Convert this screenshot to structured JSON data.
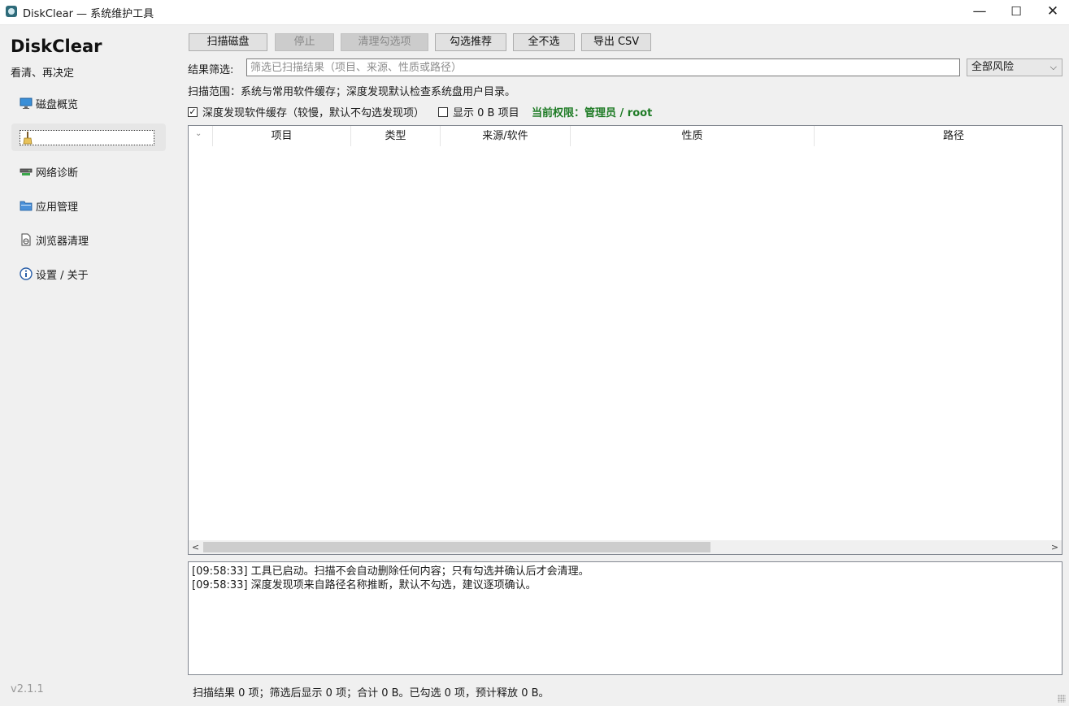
{
  "window": {
    "title": "DiskClear — 系统维护工具",
    "minimize": "—",
    "maximize": "☐",
    "close": "✕"
  },
  "sidebar": {
    "brand": "DiskClear",
    "tagline": "看清、再决定",
    "items": [
      {
        "label": "磁盘概览",
        "icon": "monitor-icon"
      },
      {
        "label": "",
        "icon": "broom-icon"
      },
      {
        "label": "网络诊断",
        "icon": "network-icon"
      },
      {
        "label": "应用管理",
        "icon": "folder-icon"
      },
      {
        "label": "浏览器清理",
        "icon": "browser-page-icon"
      },
      {
        "label": "设置 / 关于",
        "icon": "info-icon"
      }
    ],
    "version": "v2.1.1"
  },
  "toolbar": {
    "scan": "扫描磁盘",
    "stop": "停止",
    "clean_checked": "清理勾选项",
    "check_recommended": "勾选推荐",
    "uncheck_all": "全不选",
    "export_csv": "导出 CSV"
  },
  "filter": {
    "label": "结果筛选:",
    "placeholder": "筛选已扫描结果（项目、来源、性质或路径）",
    "value": "",
    "risk_selected": "全部风险"
  },
  "scope_text": "扫描范围：系统与常用软件缓存；深度发现默认检查系统盘用户目录。",
  "options": {
    "deep_discovery": {
      "label": "深度发现软件缓存（较慢，默认不勾选发现项）",
      "checked": true
    },
    "show_zero": {
      "label": "显示 0 B 项目",
      "checked": false
    },
    "privilege": "当前权限：管理员 / root"
  },
  "table": {
    "columns": [
      "项目",
      "类型",
      "来源/软件",
      "性质",
      "路径"
    ],
    "rows": []
  },
  "log": [
    "[09:58:33] 工具已启动。扫描不会自动删除任何内容；只有勾选并确认后才会清理。",
    "[09:58:33] 深度发现项来自路径名称推断，默认不勾选，建议逐项确认。"
  ],
  "status": "扫描结果 0 项；筛选后显示 0 项；合计 0 B。已勾选 0 项，预计释放 0 B。",
  "colors": {
    "privilege": "#1e7b25",
    "selected_nav": "#e6e6e6"
  }
}
